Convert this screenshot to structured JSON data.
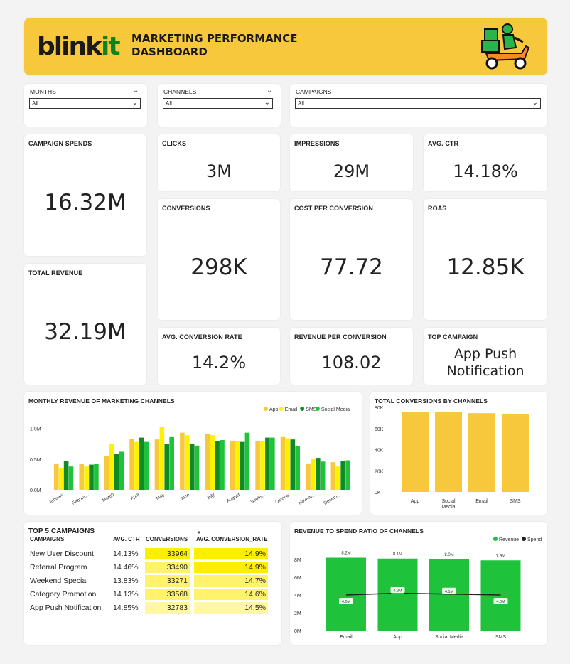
{
  "header": {
    "logo_a": "blink",
    "logo_b": "it",
    "title": "MARKETING PERFORMANCE\nDASHBOARD"
  },
  "filters": [
    {
      "label": "MONTHS",
      "value": "All"
    },
    {
      "label": "CHANNELS",
      "value": "All"
    },
    {
      "label": "CAMPAIGNS",
      "value": "All"
    }
  ],
  "kpis": {
    "campaign_spends": {
      "label": "CAMPAIGN SPENDS",
      "value": "16.32M"
    },
    "total_revenue": {
      "label": "TOTAL REVENUE",
      "value": "32.19M"
    },
    "clicks": {
      "label": "CLICKS",
      "value": "3M"
    },
    "impressions": {
      "label": "IMPRESSIONS",
      "value": "29M"
    },
    "avg_ctr": {
      "label": "AVG. CTR",
      "value": "14.18%"
    },
    "conversions": {
      "label": "CONVERSIONS",
      "value": "298K"
    },
    "cost_per_conversion": {
      "label": "COST PER CONVERSION",
      "value": "77.72"
    },
    "roas": {
      "label": "ROAS",
      "value": "12.85K"
    },
    "avg_conversion_rate": {
      "label": "AVG. CONVERSION RATE",
      "value": "14.2%"
    },
    "revenue_per_conversion": {
      "label": "REVENUE PER CONVERSION",
      "value": "108.02"
    },
    "top_campaign": {
      "label": "TOP CAMPAIGN",
      "value_line1": "App Push",
      "value_line2": "Notification"
    }
  },
  "colors": {
    "yellow": "#f8c83c",
    "bright_yellow": "#fff200",
    "dark_green": "#0f8a25",
    "green": "#1ec33b",
    "table_hi": "#ffee00",
    "table_mid": "#fff36b",
    "table_low": "#fff7a6"
  },
  "chart_data": [
    {
      "type": "bar",
      "title": "MONTHLY REVENUE OF MARKETING CHANNELS",
      "categories": [
        "January",
        "Februa...",
        "March",
        "April",
        "May",
        "June",
        "July",
        "August",
        "Septe...",
        "October",
        "Novem...",
        "Decem..."
      ],
      "series": [
        {
          "name": "App",
          "color": "#f8c83c",
          "values": [
            0.43,
            0.42,
            0.55,
            0.83,
            0.82,
            0.93,
            0.91,
            0.8,
            0.8,
            0.87,
            0.43,
            0.45
          ]
        },
        {
          "name": "Email",
          "color": "#fff200",
          "values": [
            0.35,
            0.38,
            0.75,
            0.78,
            1.03,
            0.89,
            0.89,
            0.8,
            0.79,
            0.84,
            0.5,
            0.38
          ]
        },
        {
          "name": "SMS",
          "color": "#0f8a25",
          "values": [
            0.47,
            0.41,
            0.58,
            0.85,
            0.75,
            0.75,
            0.79,
            0.78,
            0.85,
            0.82,
            0.52,
            0.47
          ]
        },
        {
          "name": "Social Media",
          "color": "#1ec33b",
          "values": [
            0.38,
            0.42,
            0.62,
            0.78,
            0.87,
            0.72,
            0.81,
            0.93,
            0.85,
            0.71,
            0.46,
            0.48
          ]
        }
      ],
      "yticks": [
        "1.0M",
        "0.5M",
        "0.0M"
      ],
      "ylim": [
        0,
        1.1
      ],
      "legend": "top-right"
    },
    {
      "type": "bar",
      "title": "TOTAL CONVERSIONS BY CHANNELS",
      "categories": [
        "App",
        "Social Media",
        "Email",
        "SMS"
      ],
      "values": [
        75800,
        75500,
        74500,
        73300
      ],
      "yticks": [
        "80K",
        "60K",
        "40K",
        "20K",
        "0K"
      ],
      "ylim": [
        0,
        80000
      ]
    },
    {
      "type": "bar",
      "title": "REVENUE TO SPEND RATIO OF CHANNELS",
      "categories": [
        "Email",
        "App",
        "Social Media",
        "SMS"
      ],
      "series": [
        {
          "name": "Revenue",
          "color": "#1ec33b",
          "values": [
            8.2,
            8.1,
            8.0,
            7.9
          ],
          "labels": [
            "8.2M",
            "8.1M",
            "8.0M",
            "7.9M"
          ]
        },
        {
          "name": "Spend",
          "color": "#222222",
          "values": [
            4.0,
            4.2,
            4.1,
            4.0
          ],
          "labels": [
            "4.0M",
            "4.2M",
            "4.1M",
            "4.0M"
          ]
        }
      ],
      "yticks": [
        "8M",
        "6M",
        "4M",
        "2M",
        "0M"
      ],
      "ylim": [
        0,
        8
      ],
      "legend": "top-right"
    }
  ],
  "top5": {
    "title": "TOP 5 CAMPAIGNS",
    "headers": [
      "CAMPAIGNS",
      "AVG. CTR",
      "CONVERSIONS",
      "AVG. CONVERSION_RATE"
    ],
    "rows": [
      {
        "campaign": "New User Discount",
        "ctr": "14.13%",
        "conversions": "33964",
        "rate": "14.9%"
      },
      {
        "campaign": "Referral Program",
        "ctr": "14.46%",
        "conversions": "33490",
        "rate": "14.9%"
      },
      {
        "campaign": "Weekend Special",
        "ctr": "13.83%",
        "conversions": "33271",
        "rate": "14.7%"
      },
      {
        "campaign": "Category Promotion",
        "ctr": "14.13%",
        "conversions": "33568",
        "rate": "14.6%"
      },
      {
        "campaign": "App Push Notification",
        "ctr": "14.85%",
        "conversions": "32783",
        "rate": "14.5%"
      }
    ]
  }
}
